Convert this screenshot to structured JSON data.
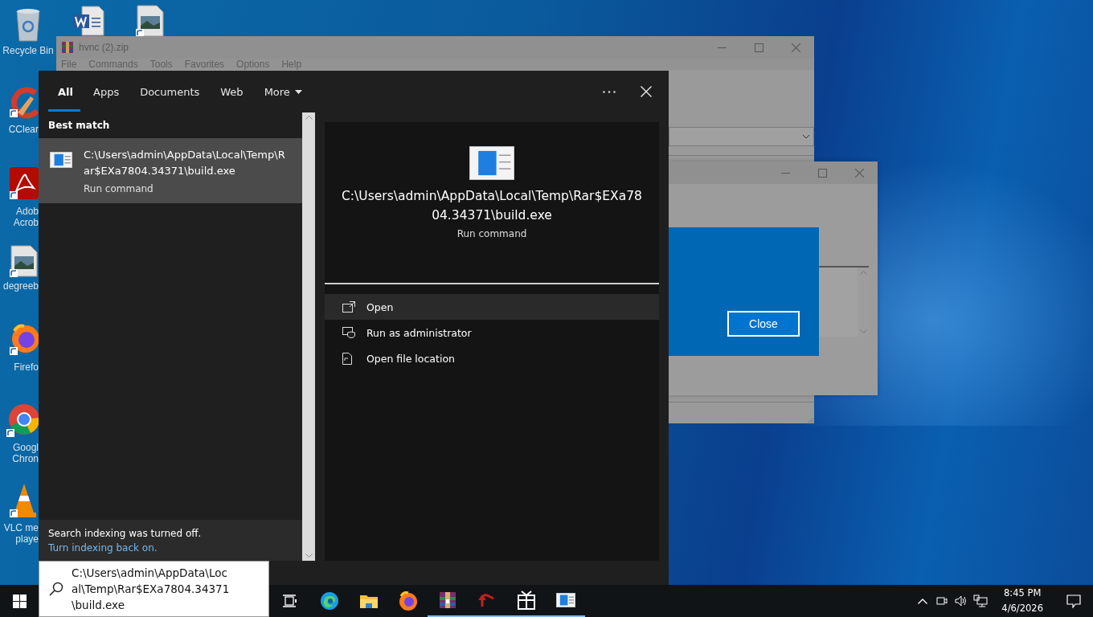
{
  "desktop": {
    "icons": [
      {
        "kind": "recycle",
        "label_lines": [
          "Recycle Bin"
        ]
      },
      {
        "kind": "word"
      },
      {
        "kind": "image"
      },
      {
        "kind": "ccleaner",
        "label_lines": [
          "CClear"
        ]
      },
      {
        "kind": "acrobat",
        "label_lines": [
          "Adob",
          "Acrob"
        ]
      },
      {
        "kind": "image",
        "label_lines": [
          "degreeb"
        ]
      },
      {
        "kind": "firefox",
        "label_lines": [
          "Firefo"
        ]
      },
      {
        "kind": "chrome",
        "label_lines": [
          "Googl",
          "Chron"
        ]
      },
      {
        "kind": "vlc",
        "label_lines": [
          "VLC me",
          "playe"
        ]
      }
    ]
  },
  "windows": [
    {
      "kind": "archive",
      "title": "hvnc (2).zip",
      "menu": [
        "File",
        "Commands",
        "Tools",
        "Favorites",
        "Options",
        "Help"
      ]
    },
    {
      "kind": "dialog",
      "button": "Close"
    }
  ],
  "search_panel": {
    "tabs": [
      {
        "label": "All",
        "selected": true
      },
      {
        "label": "Apps",
        "selected": false
      },
      {
        "label": "Documents",
        "selected": false
      },
      {
        "label": "Web",
        "selected": false
      },
      {
        "label": "More",
        "selected": false,
        "kind": "dropdown"
      }
    ],
    "section": "Best match",
    "result": {
      "title": "C:\\Users\\admin\\AppData\\Local\\Temp\\Rar$EXa7804.34371\\build.exe",
      "subtitle": "Run command",
      "selected": true
    },
    "notice": {
      "text": "Search indexing was turned off.",
      "link": "Turn indexing back on."
    },
    "preview": {
      "title": "C:\\Users\\admin\\AppData\\Local\\Temp\\Rar$EXa7804.34371\\build.exe",
      "subtitle": "Run command",
      "actions": [
        {
          "kind": "open",
          "label": "Open",
          "selected": true
        },
        {
          "kind": "admin",
          "label": "Run as administrator",
          "selected": false
        },
        {
          "kind": "folder",
          "label": "Open file location",
          "selected": false
        }
      ]
    }
  },
  "taskbar": {
    "search_value": "C:\\Users\\admin\\AppData\\Local\\Temp\\Rar$EXa7804.34371\\build.exe",
    "apps": [
      {
        "kind": "taskview",
        "running": false
      },
      {
        "kind": "edge",
        "running": false
      },
      {
        "kind": "explorer",
        "running": false
      },
      {
        "kind": "firefox",
        "running": false
      },
      {
        "kind": "winrar",
        "running": true
      },
      {
        "kind": "arrow",
        "running": true
      },
      {
        "kind": "gift",
        "running": true
      },
      {
        "kind": "program",
        "running": true
      }
    ],
    "clock": {
      "time": "8:45 PM",
      "date": "4/6/2026"
    }
  }
}
